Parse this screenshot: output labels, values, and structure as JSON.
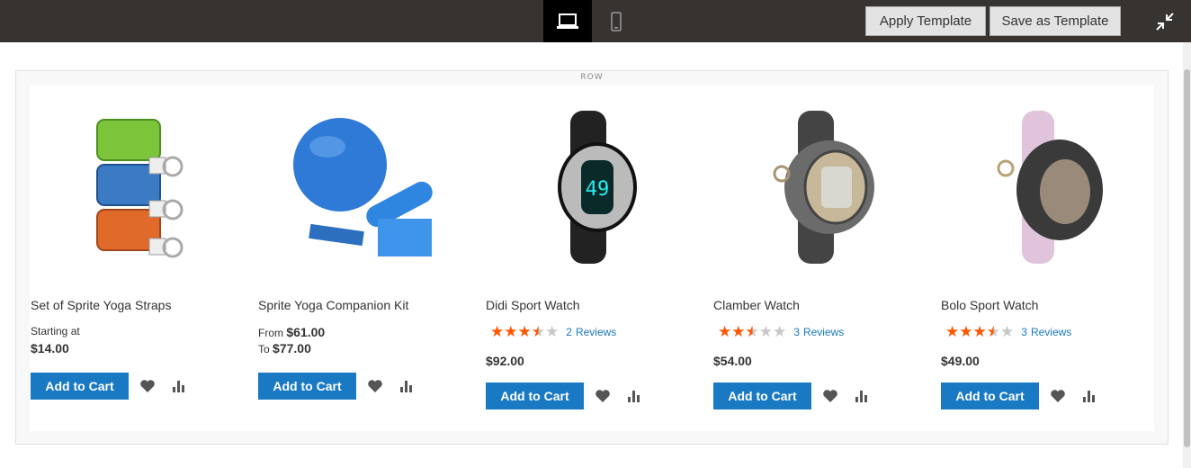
{
  "toolbar": {
    "apply_label": "Apply Template",
    "save_label": "Save as Template",
    "desktop_icon": "desktop-view-icon",
    "mobile_icon": "mobile-view-icon",
    "collapse_icon": "collapse-fullscreen-icon"
  },
  "row": {
    "label": "ROW"
  },
  "products": [
    {
      "name": "Set of Sprite Yoga Straps",
      "price_prefix_1": "Starting at",
      "price_1": "$14.00",
      "cart_label": "Add to Cart"
    },
    {
      "name": "Sprite Yoga Companion Kit",
      "price_prefix_1": "From",
      "price_1": "$61.00",
      "price_prefix_2": "To",
      "price_2": "$77.00",
      "cart_label": "Add to Cart"
    },
    {
      "name": "Didi Sport Watch",
      "rating": 3.5,
      "review_count": "2",
      "review_label": "Reviews",
      "price": "$92.00",
      "cart_label": "Add to Cart"
    },
    {
      "name": "Clamber Watch",
      "rating": 2.5,
      "review_count": "3",
      "review_label": "Reviews",
      "price": "$54.00",
      "cart_label": "Add to Cart"
    },
    {
      "name": "Bolo Sport Watch",
      "rating": 3.5,
      "review_count": "3",
      "review_label": "Reviews",
      "price": "$49.00",
      "cart_label": "Add to Cart"
    }
  ],
  "colors": {
    "accent": "#1979c3",
    "star": "#ff5501",
    "topbar": "#373330"
  }
}
